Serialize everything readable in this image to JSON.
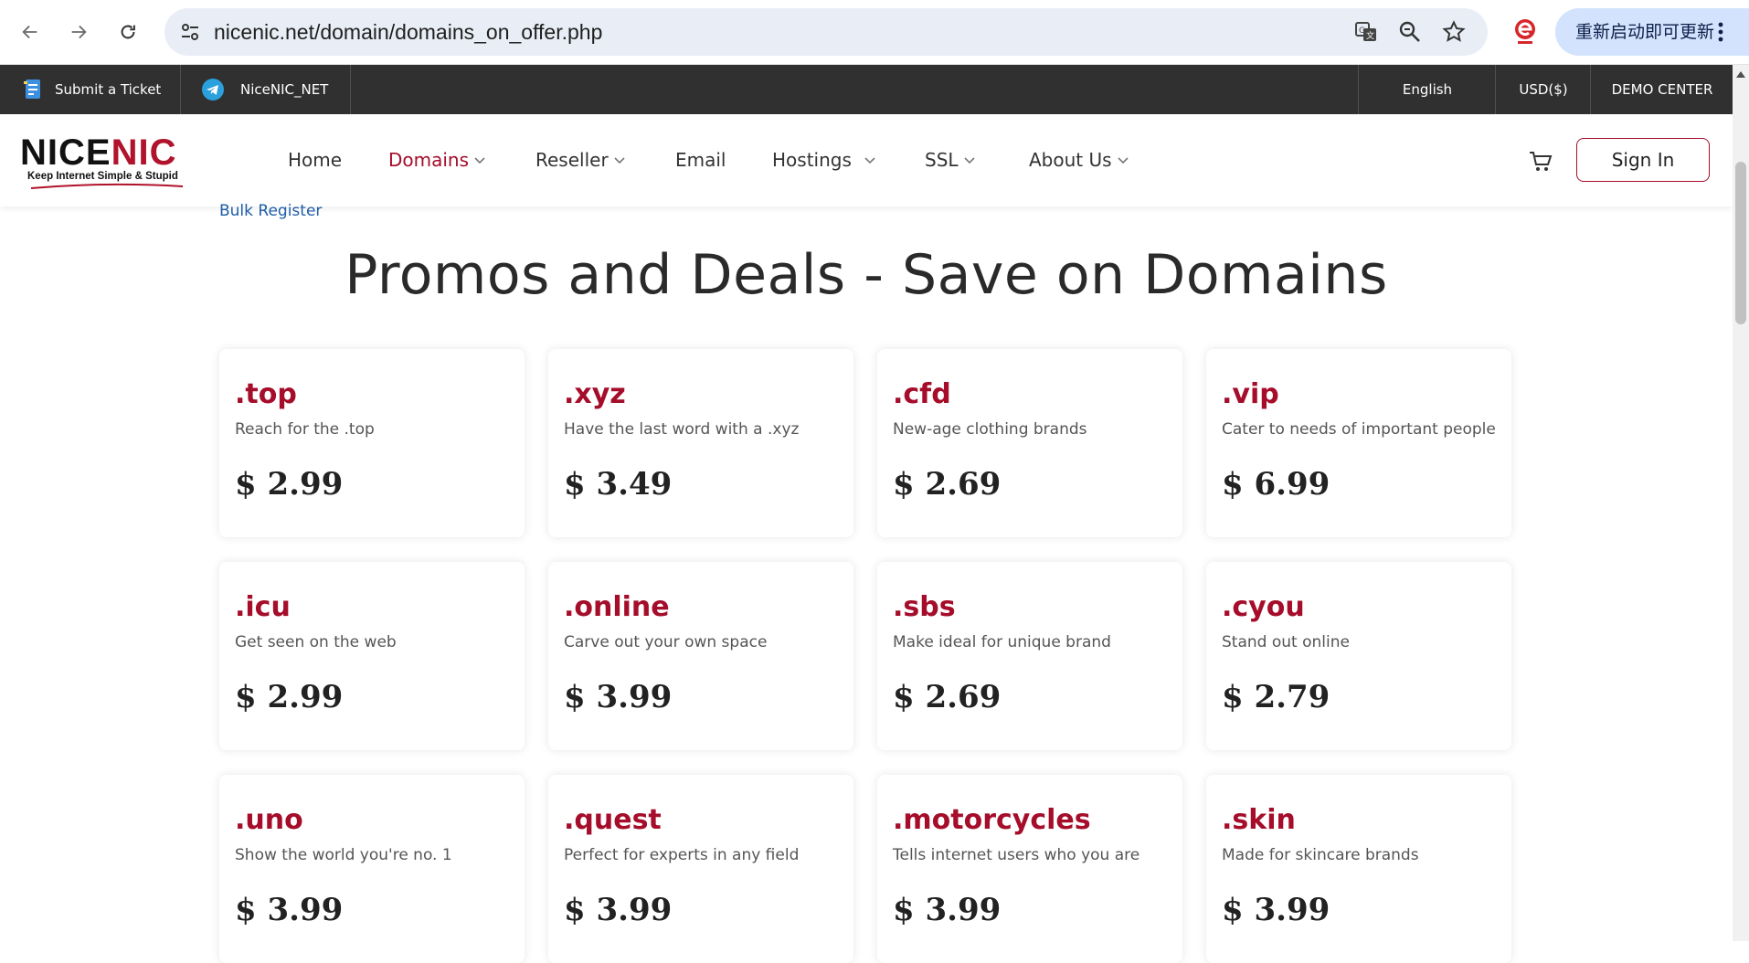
{
  "browser": {
    "url": "nicenic.net/domain/domains_on_offer.php",
    "update_label": "重新启动即可更新"
  },
  "topbar": {
    "ticket_label": "Submit a Ticket",
    "telegram_label": "NiceNIC_NET",
    "language": "English",
    "currency": "USD($)",
    "demo": "DEMO CENTER"
  },
  "header": {
    "logo_text_black": "NICE",
    "logo_text_red": "NIC",
    "logo_tagline": "Keep Internet Simple & Stupid",
    "menu": [
      {
        "label": "Home"
      },
      {
        "label": "Domains"
      },
      {
        "label": "Reseller"
      },
      {
        "label": "Email"
      },
      {
        "label": "Hostings"
      },
      {
        "label": "SSL"
      },
      {
        "label": "About Us"
      }
    ],
    "signin_label": "Sign In"
  },
  "content": {
    "breadcrumb": "Bulk Register",
    "title": "Promos and Deals - Save on Domains",
    "cards": [
      {
        "tld": ".top",
        "desc": "Reach for the .top",
        "price": "$ 2.99"
      },
      {
        "tld": ".xyz",
        "desc": "Have the last word with a .xyz",
        "price": "$ 3.49"
      },
      {
        "tld": ".cfd",
        "desc": "New-age clothing brands",
        "price": "$ 2.69"
      },
      {
        "tld": ".vip",
        "desc": "Cater to needs of important people",
        "price": "$ 6.99"
      },
      {
        "tld": ".icu",
        "desc": "Get seen on the web",
        "price": "$ 2.99"
      },
      {
        "tld": ".online",
        "desc": "Carve out your own space",
        "price": "$ 3.99"
      },
      {
        "tld": ".sbs",
        "desc": "Make ideal for unique brand",
        "price": "$ 2.69"
      },
      {
        "tld": ".cyou",
        "desc": "Stand out online",
        "price": "$ 2.79"
      },
      {
        "tld": ".uno",
        "desc": "Show the world you're no. 1",
        "price": "$ 3.99"
      },
      {
        "tld": ".quest",
        "desc": "Perfect for experts in any field",
        "price": "$ 3.99"
      },
      {
        "tld": ".motorcycles",
        "desc": "Tells internet users who you are",
        "price": "$ 3.99"
      },
      {
        "tld": ".skin",
        "desc": "Made for skincare brands",
        "price": "$ 3.99"
      }
    ]
  },
  "colors": {
    "brand_red": "#a50d2a",
    "topbar_bg": "#303030",
    "link_blue": "#1e5da8"
  }
}
